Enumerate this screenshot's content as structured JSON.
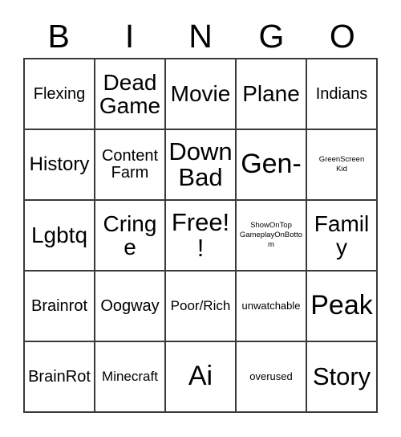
{
  "card": {
    "header": [
      "B",
      "I",
      "N",
      "G",
      "O"
    ],
    "rows": [
      [
        {
          "text": "Flexing",
          "size": "sz-l"
        },
        {
          "text": "Dead\nGame",
          "size": "sz-xxl"
        },
        {
          "text": "Movie",
          "size": "sz-xxl"
        },
        {
          "text": "Plane",
          "size": "sz-xxl"
        },
        {
          "text": "Indians",
          "size": "sz-l"
        }
      ],
      [
        {
          "text": "History",
          "size": "sz-xl"
        },
        {
          "text": "Content\nFarm",
          "size": "sz-l"
        },
        {
          "text": "Down\nBad",
          "size": "sz-3xl"
        },
        {
          "text": "Gen-",
          "size": "sz-4xl"
        },
        {
          "text": "GreenScreen\nKid",
          "size": "sz-xs"
        }
      ],
      [
        {
          "text": "Lgbtq",
          "size": "sz-xxl"
        },
        {
          "text": "Cringe",
          "size": "sz-xxl"
        },
        {
          "text": "Free!!",
          "size": "sz-3xl"
        },
        {
          "text": "ShowOnTop\nGameplayOnBottom",
          "size": "sz-xs"
        },
        {
          "text": "Family",
          "size": "sz-xxl"
        }
      ],
      [
        {
          "text": "Brainrot",
          "size": "sz-l"
        },
        {
          "text": "Oogway",
          "size": "sz-l"
        },
        {
          "text": "Poor/Rich",
          "size": "sz-m"
        },
        {
          "text": "unwatchable",
          "size": "sz-s"
        },
        {
          "text": "Peak",
          "size": "sz-4xl"
        }
      ],
      [
        {
          "text": "BrainRot",
          "size": "sz-l"
        },
        {
          "text": "Minecraft",
          "size": "sz-m"
        },
        {
          "text": "Ai",
          "size": "sz-4xl"
        },
        {
          "text": "overused",
          "size": "sz-s"
        },
        {
          "text": "Story",
          "size": "sz-3xl"
        }
      ]
    ],
    "free_space_label": "Free!!"
  },
  "colors": {
    "background": "#ffffff",
    "border": "#3a3a3a",
    "text": "#000000"
  }
}
